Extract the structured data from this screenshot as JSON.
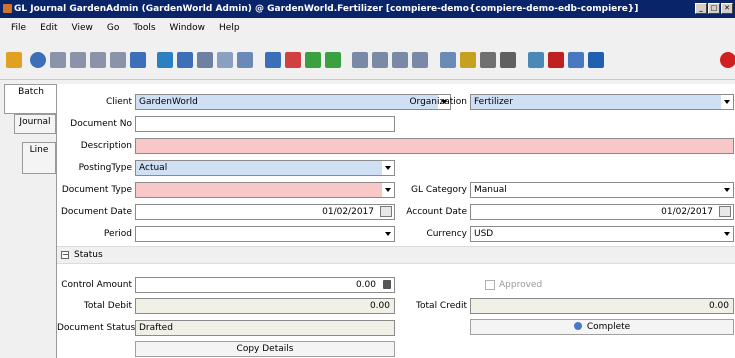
{
  "window": {
    "title": "GL Journal  GardenAdmin (GardenWorld Admin) @ GardenWorld.Fertilizer [compiere-demo{compiere-demo-edb-compiere}]",
    "buttons": [
      "_",
      "□",
      "✕"
    ]
  },
  "menu": {
    "items": [
      "File",
      "Edit",
      "View",
      "Go",
      "Tools",
      "Window",
      "Help"
    ]
  },
  "toolbar": {
    "icons": [
      {
        "name": "undo-icon",
        "color": "#e0a020"
      },
      {
        "name": "help-icon",
        "color": "#3d6fb8"
      },
      {
        "name": "new-record-icon",
        "color": "#8a93a8"
      },
      {
        "name": "copy-record-icon",
        "color": "#8a93a8"
      },
      {
        "name": "delete-record-icon",
        "color": "#8a93a8"
      },
      {
        "name": "delete-selection-icon",
        "color": "#8a93a8"
      },
      {
        "name": "save-icon",
        "color": "#3d6fb8"
      },
      {
        "name": "refresh-icon",
        "color": "#2a80c0"
      },
      {
        "name": "find-icon",
        "color": "#3d6fb8"
      },
      {
        "name": "attachment-icon",
        "color": "#7080a0"
      },
      {
        "name": "chat-icon",
        "color": "#8aa0c0"
      },
      {
        "name": "grid-toggle-icon",
        "color": "#6a88b8"
      },
      {
        "name": "history-icon",
        "color": "#3d6fb8"
      },
      {
        "name": "home-icon",
        "color": "#d04040"
      },
      {
        "name": "parent-icon",
        "color": "#3aa040"
      },
      {
        "name": "detail-icon",
        "color": "#3aa040"
      },
      {
        "name": "first-record-icon",
        "color": "#7a8aa6"
      },
      {
        "name": "previous-record-icon",
        "color": "#7a8aa6"
      },
      {
        "name": "next-record-icon",
        "color": "#7a8aa6"
      },
      {
        "name": "last-record-icon",
        "color": "#7a8aa6"
      },
      {
        "name": "report-icon",
        "color": "#6a8ab8"
      },
      {
        "name": "archive-icon",
        "color": "#c8a020"
      },
      {
        "name": "print-preview-icon",
        "color": "#707070"
      },
      {
        "name": "print-icon",
        "color": "#606060"
      },
      {
        "name": "zoom-across-icon",
        "color": "#4a88b8"
      },
      {
        "name": "active-workflows-icon",
        "color": "#c02020"
      },
      {
        "name": "product-info-icon",
        "color": "#4a78c0"
      },
      {
        "name": "request-icon",
        "color": "#2060b0"
      },
      {
        "name": "close-window-icon",
        "color": "#d02020"
      }
    ]
  },
  "tabs": [
    "Batch",
    "Journal",
    "Line"
  ],
  "form": {
    "client_label": "Client",
    "client_value": "GardenWorld",
    "organization_label": "Organization",
    "organization_value": "Fertilizer",
    "document_no_label": "Document No",
    "document_no_value": "",
    "description_label": "Description",
    "description_value": "",
    "posting_type_label": "PostingType",
    "posting_type_value": "Actual",
    "document_type_label": "Document Type",
    "document_type_value": "",
    "gl_category_label": "GL Category",
    "gl_category_value": "Manual",
    "document_date_label": "Document Date",
    "document_date_value": "01/02/2017",
    "account_date_label": "Account Date",
    "account_date_value": "01/02/2017",
    "period_label": "Period",
    "period_value": "",
    "currency_label": "Currency",
    "currency_value": "USD",
    "status_section": "Status",
    "control_amount_label": "Control Amount",
    "control_amount_value": "0.00",
    "approved_label": "Approved",
    "total_debit_label": "Total Debit",
    "total_debit_value": "0.00",
    "total_credit_label": "Total Credit",
    "total_credit_value": "0.00",
    "document_status_label": "Document Status",
    "document_status_value": "Drafted",
    "complete_button": "Complete",
    "copy_details_button": "Copy Details"
  }
}
